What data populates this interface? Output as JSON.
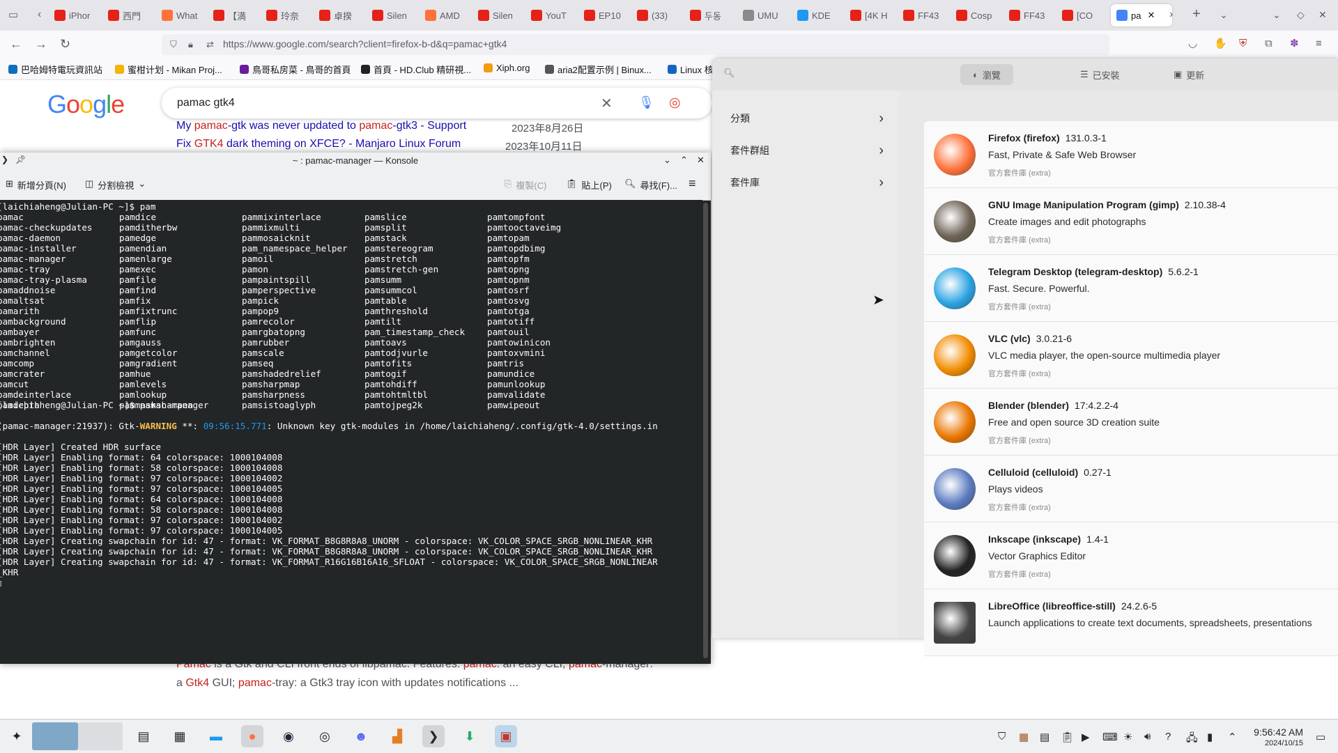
{
  "browser": {
    "tabs": [
      {
        "label": "iPhor",
        "color": "#e62117"
      },
      {
        "label": "西門",
        "color": "#e62117"
      },
      {
        "label": "What",
        "color": "#ff7139"
      },
      {
        "label": "【満",
        "color": "#e62117"
      },
      {
        "label": "玲奈",
        "color": "#e62117"
      },
      {
        "label": "卓揆",
        "color": "#e62117"
      },
      {
        "label": "Silen",
        "color": "#e62117"
      },
      {
        "label": "AMD",
        "color": "#ff7139"
      },
      {
        "label": "Silen",
        "color": "#e62117"
      },
      {
        "label": "YouT",
        "color": "#e62117"
      },
      {
        "label": "EP10",
        "color": "#e62117"
      },
      {
        "label": "(33)",
        "color": "#e62117"
      },
      {
        "label": "두동",
        "color": "#e62117"
      },
      {
        "label": "UMU",
        "color": "#8a8a8a"
      },
      {
        "label": "KDE",
        "color": "#1d99f3"
      },
      {
        "label": "[4K H",
        "color": "#e62117"
      },
      {
        "label": "FF43",
        "color": "#e62117"
      },
      {
        "label": "Cosp",
        "color": "#e62117"
      },
      {
        "label": "FF43",
        "color": "#e62117"
      },
      {
        "label": "[CO",
        "color": "#e62117"
      },
      {
        "label": "pa",
        "color": "#4285f4"
      }
    ],
    "url": "https://www.google.com/search?client=firefox-b-d&q=pamac+gtk4",
    "bookmarks": [
      {
        "label": "巴哈姆特電玩資訊站",
        "color": "#0d6fbe"
      },
      {
        "label": "蜜柑计划 - Mikan Proj...",
        "color": "#f4b400"
      },
      {
        "label": "鳥哥私房菜 - 鳥哥的首頁",
        "color": "#6a1b9a"
      },
      {
        "label": "首頁 - HD.Club 精研視...",
        "color": "#222222"
      },
      {
        "label": "Xiph.org",
        "color": "#f39c12"
      },
      {
        "label": "aria2配置示例 | Binux...",
        "color": "#555555"
      },
      {
        "label": "Linux 核",
        "color": "#1565c0"
      }
    ]
  },
  "google": {
    "logo": "Google",
    "query": "pamac gtk4",
    "results": [
      {
        "pre": "My ",
        "hl1": "pamac",
        "mid": "-gtk was never updated to ",
        "hl2": "pamac",
        "post": "-gtk3 - Support",
        "date": "2023年8月26日"
      },
      {
        "pre": "Fix ",
        "hl1": "GTK4",
        "mid": " dark theming on XFCE? - Manjaro Linux Forum",
        "hl2": "",
        "post": "",
        "date": "2023年10月11日"
      }
    ],
    "snippet1": {
      "a": "Pamac",
      "b": " is a Gtk and CLI front ends of libpamac. Features: ",
      "c": "pamac",
      "d": ": an easy CLI, ",
      "e": "pamac",
      "f": "-manager:"
    },
    "snippet2": {
      "a": "a ",
      "b": "Gtk4",
      "c": " GUI; ",
      "d": "pamac",
      "e": "-tray: a Gtk3 tray icon with updates notifications ..."
    }
  },
  "konsole": {
    "title": "~ : pamac-manager — Konsole",
    "new_tab": "新增分頁(N)",
    "split": "分割檢視",
    "copy": "複製(C)",
    "paste": "貼上(P)",
    "find": "尋找(F)...",
    "prompt1": "[laichiaheng@Julian-PC ~]$ pam",
    "columns": [
      [
        "pamac",
        "pamac-checkupdates",
        "pamac-daemon",
        "pamac-installer",
        "pamac-manager",
        "pamac-tray",
        "pamac-tray-plasma",
        "pamaddnoise",
        "pamaltsat",
        "pamarith",
        "pambackground",
        "pambayer",
        "pambrighten",
        "pamchannel",
        "pamcomp",
        "pamcrater",
        "pamcut",
        "pamdeinterlace",
        "pamdepth"
      ],
      [
        "pamdice",
        "pamditherbw",
        "pamedge",
        "pamendian",
        "pamenlarge",
        "pamexec",
        "pamfile",
        "pamfind",
        "pamfix",
        "pamfixtrunc",
        "pamflip",
        "pamfunc",
        "pamgauss",
        "pamgetcolor",
        "pamgradient",
        "pamhue",
        "pamlevels",
        "pamlookup",
        "pammasksharpen"
      ],
      [
        "pammixinterlace",
        "pammixmulti",
        "pammosaicknit",
        "pam_namespace_helper",
        "pamoil",
        "pamon",
        "pampaintspill",
        "pamperspective",
        "pampick",
        "pampop9",
        "pamrecolor",
        "pamrgbatopng",
        "pamrubber",
        "pamscale",
        "pamseq",
        "pamshadedrelief",
        "pamsharpmap",
        "pamsharpness",
        "pamsistoaglyph"
      ],
      [
        "pamslice",
        "pamsplit",
        "pamstack",
        "pamstereogram",
        "pamstretch",
        "pamstretch-gen",
        "pamsumm",
        "pamsummcol",
        "pamtable",
        "pamthreshold",
        "pamtilt",
        "pam_timestamp_check",
        "pamtoavs",
        "pamtodjvurle",
        "pamtofits",
        "pamtogif",
        "pamtohdiff",
        "pamtohtmltbl",
        "pamtojpeg2k"
      ],
      [
        "pamtompfont",
        "pamtooctaveimg",
        "pamtopam",
        "pamtopdbimg",
        "pamtopfm",
        "pamtopng",
        "pamtopnm",
        "pamtosrf",
        "pamtosvg",
        "pamtotga",
        "pamtotiff",
        "pamtouil",
        "pamtowinicon",
        "pamtoxvmini",
        "pamtris",
        "pamundice",
        "pamunlookup",
        "pamvalidate",
        "pamwipeout"
      ]
    ],
    "prompt2": "[laichiaheng@Julian-PC ~]$ pamac-manager",
    "warn_prefix": "(pamac-manager:21937): Gtk-",
    "warn_word": "WARNING",
    "warn_stars": " **: ",
    "warn_time": "09:56:15.771",
    "warn_msg": ": Unknown key gtk-modules in /home/laichiaheng/.config/gtk-4.0/settings.in",
    "log_lines": [
      "[HDR Layer] Created HDR surface",
      "[HDR Layer] Enabling format: 64 colorspace: 1000104008",
      "[HDR Layer] Enabling format: 58 colorspace: 1000104008",
      "[HDR Layer] Enabling format: 97 colorspace: 1000104002",
      "[HDR Layer] Enabling format: 97 colorspace: 1000104005",
      "[HDR Layer] Enabling format: 64 colorspace: 1000104008",
      "[HDR Layer] Enabling format: 58 colorspace: 1000104008",
      "[HDR Layer] Enabling format: 97 colorspace: 1000104002",
      "[HDR Layer] Enabling format: 97 colorspace: 1000104005",
      "[HDR Layer] Creating swapchain for id: 47 - format: VK_FORMAT_B8G8R8A8_UNORM - colorspace: VK_COLOR_SPACE_SRGB_NONLINEAR_KHR",
      "[HDR Layer] Creating swapchain for id: 47 - format: VK_FORMAT_B8G8R8A8_UNORM - colorspace: VK_COLOR_SPACE_SRGB_NONLINEAR_KHR",
      "[HDR Layer] Creating swapchain for id: 47 - format: VK_FORMAT_R16G16B16A16_SFLOAT - colorspace: VK_COLOR_SPACE_SRGB_NONLINEAR",
      "_KHR"
    ]
  },
  "pamac": {
    "tabs": [
      "瀏覽",
      "已安裝",
      "更新"
    ],
    "sidebar": [
      "分類",
      "套件群組",
      "套件庫"
    ],
    "packages": [
      {
        "name": "Firefox (firefox)",
        "version": "131.0.3-1",
        "desc": "Fast, Private & Safe Web Browser",
        "repo": "官方套件庫 (extra)",
        "icon": "firefox-icon",
        "color": "#ff7139"
      },
      {
        "name": "GNU Image Manipulation Program (gimp)",
        "version": "2.10.38-4",
        "desc": "Create images and edit photographs",
        "repo": "官方套件庫 (extra)",
        "icon": "gimp-icon",
        "color": "#6e6355"
      },
      {
        "name": "Telegram Desktop (telegram-desktop)",
        "version": "5.6.2-1",
        "desc": "Fast. Secure. Powerful.",
        "repo": "官方套件庫 (extra)",
        "icon": "telegram-icon",
        "color": "#2aa3e2"
      },
      {
        "name": "VLC (vlc)",
        "version": "3.0.21-6",
        "desc": "VLC media player, the open-source multimedia player",
        "repo": "官方套件庫 (extra)",
        "icon": "vlc-icon",
        "color": "#f28c00"
      },
      {
        "name": "Blender (blender)",
        "version": "17:4.2.2-4",
        "desc": "Free and open source 3D creation suite",
        "repo": "官方套件庫 (extra)",
        "icon": "blender-icon",
        "color": "#ea7600"
      },
      {
        "name": "Celluloid (celluloid)",
        "version": "0.27-1",
        "desc": "Plays videos",
        "repo": "官方套件庫 (extra)",
        "icon": "celluloid-icon",
        "color": "#5c7bc0"
      },
      {
        "name": "Inkscape (inkscape)",
        "version": "1.4-1",
        "desc": "Vector Graphics Editor",
        "repo": "官方套件庫 (extra)",
        "icon": "inkscape-icon",
        "color": "#222222"
      },
      {
        "name": "LibreOffice (libreoffice-still)",
        "version": "24.2.6-5",
        "desc": "Launch applications to create text documents, spreadsheets, presentations",
        "repo": "",
        "icon": "libreoffice-icon",
        "color": "#444444"
      }
    ]
  },
  "taskbar": {
    "time": "9:56:42 AM",
    "date": "2024/10/15"
  }
}
